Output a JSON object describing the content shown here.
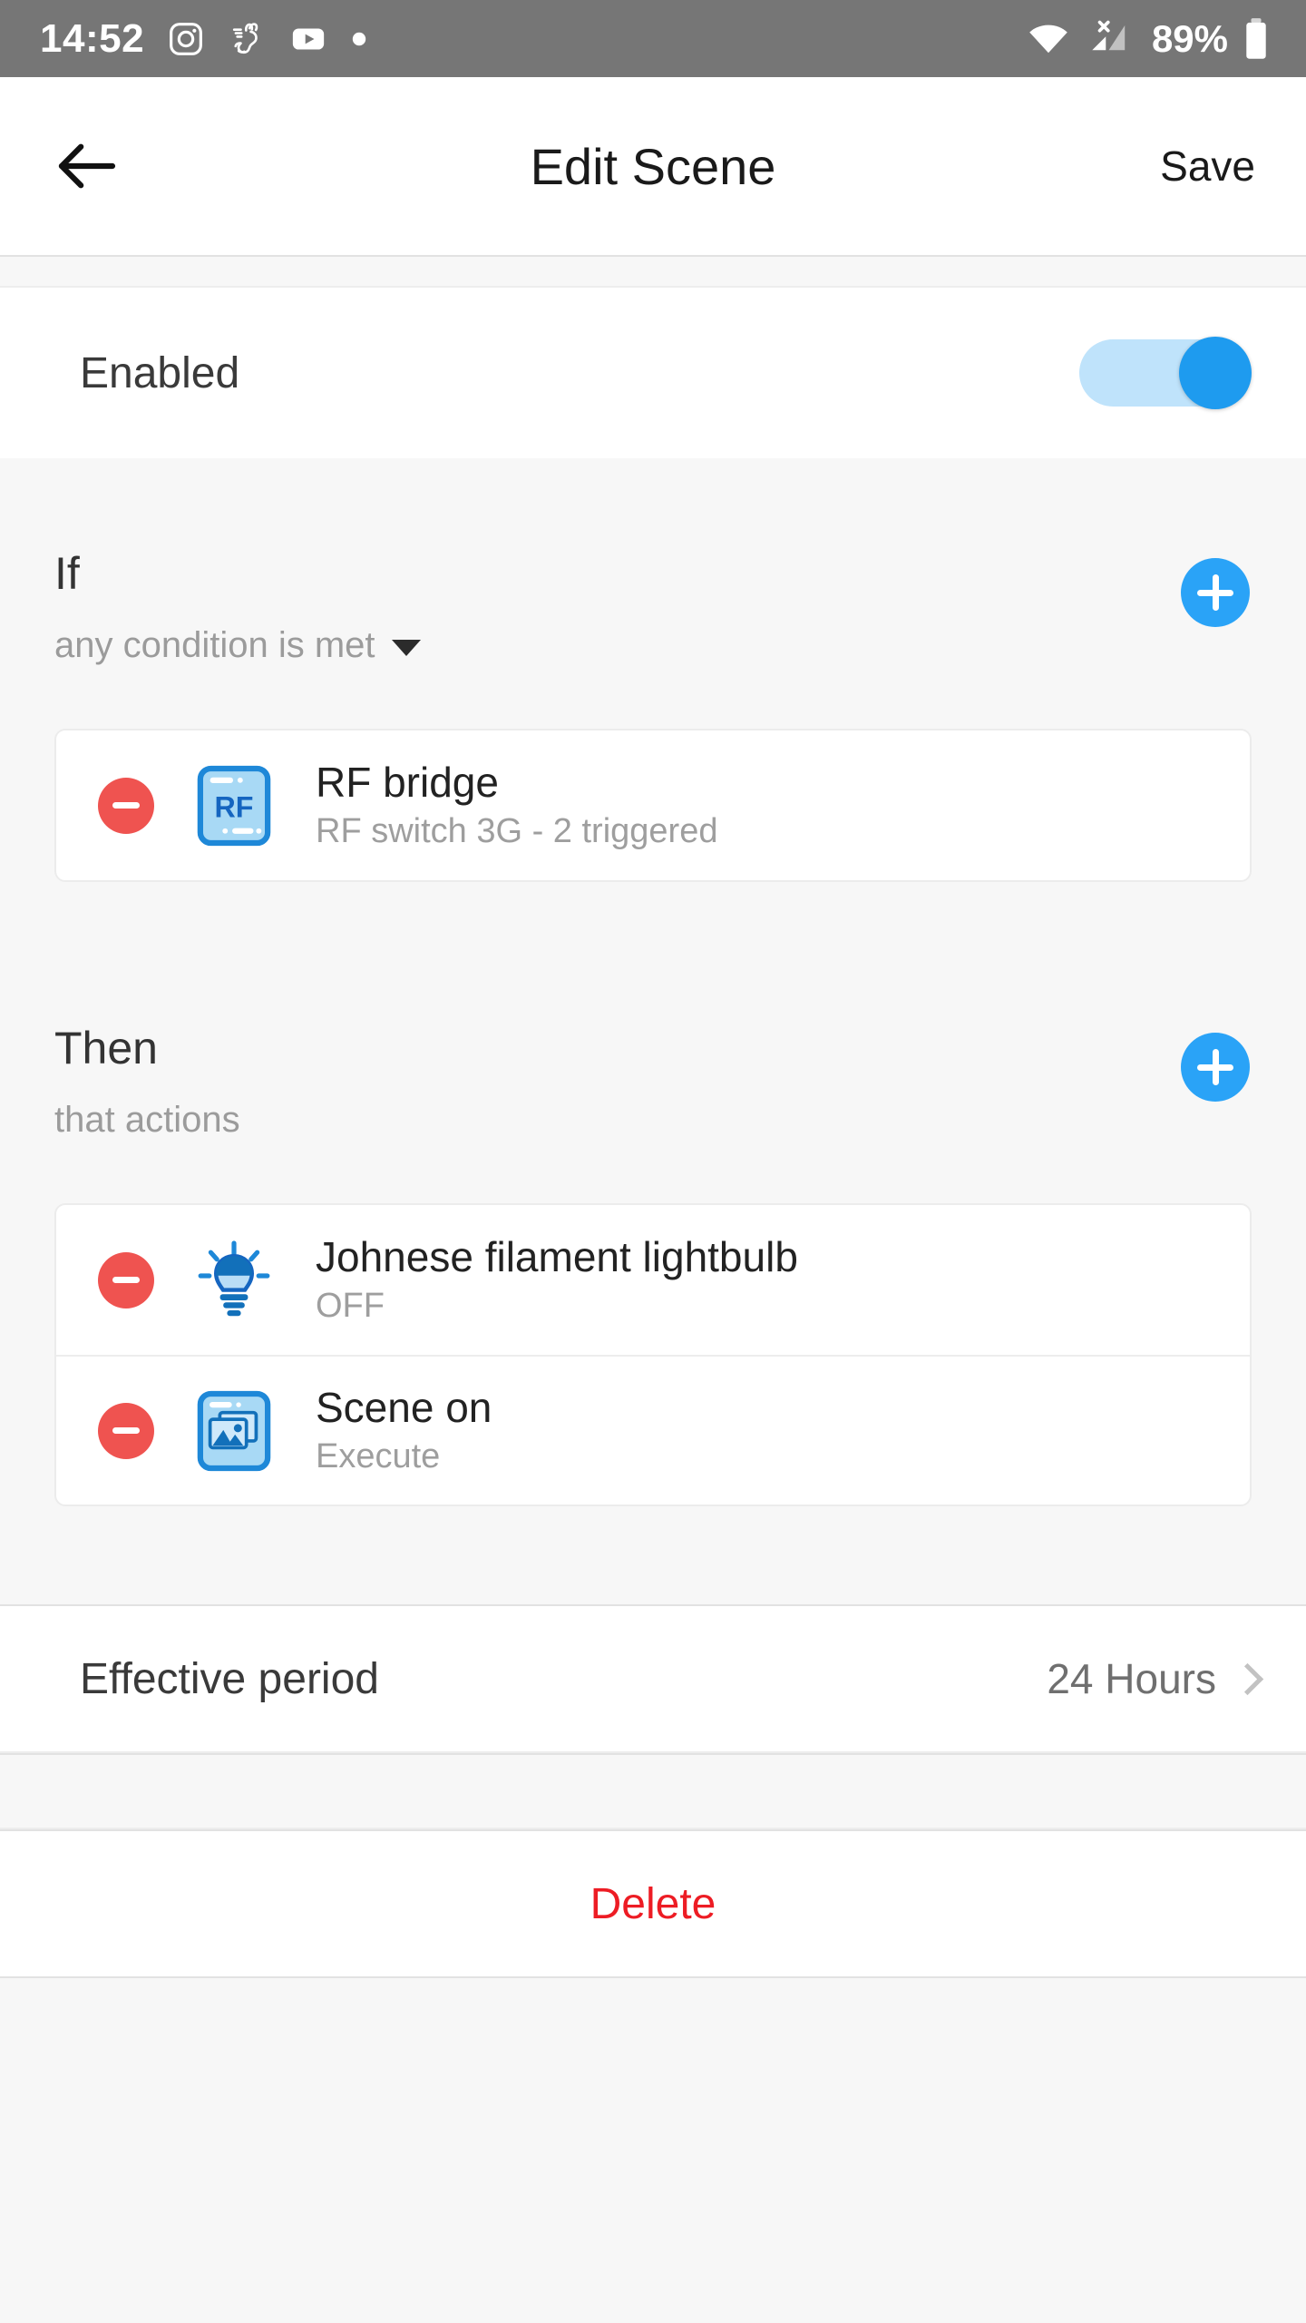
{
  "status_bar": {
    "time": "14:52",
    "battery_percent": "89%",
    "icons": [
      "instagram-icon",
      "rabbit-app-icon",
      "youtube-icon",
      "dot-icon",
      "wifi-icon",
      "cellular-no-sim-icon",
      "battery-icon"
    ]
  },
  "header": {
    "back_label": "back-arrow",
    "title": "Edit Scene",
    "save_label": "Save"
  },
  "enabled_row": {
    "label": "Enabled",
    "toggle_on": true
  },
  "if_section": {
    "title": "If",
    "subtitle": "any condition is met",
    "add_label": "+",
    "conditions": [
      {
        "icon": "rf-bridge-icon",
        "name": "RF bridge",
        "state": "RF switch 3G - 2 triggered",
        "remove_label": "-"
      }
    ]
  },
  "then_section": {
    "title": "Then",
    "subtitle": "that actions",
    "add_label": "+",
    "actions": [
      {
        "icon": "lightbulb-icon",
        "name": "Johnese filament lightbulb",
        "state": "OFF",
        "remove_label": "-"
      },
      {
        "icon": "scene-picture-icon",
        "name": "Scene on",
        "state": "Execute",
        "remove_label": "-"
      }
    ]
  },
  "effective_period": {
    "label": "Effective period",
    "value": "24 Hours"
  },
  "delete": {
    "label": "Delete"
  },
  "colors": {
    "accent_blue": "#2aa3f7",
    "toggle_track": "#bfe3fb",
    "toggle_knob": "#1e9bef",
    "remove_red": "#ef5350",
    "delete_red": "#ed1c24",
    "status_bar_bg": "#767676",
    "page_bg": "#f7f7f7",
    "icon_blue": "#1e88d8",
    "icon_fill": "#a8d9f5"
  }
}
